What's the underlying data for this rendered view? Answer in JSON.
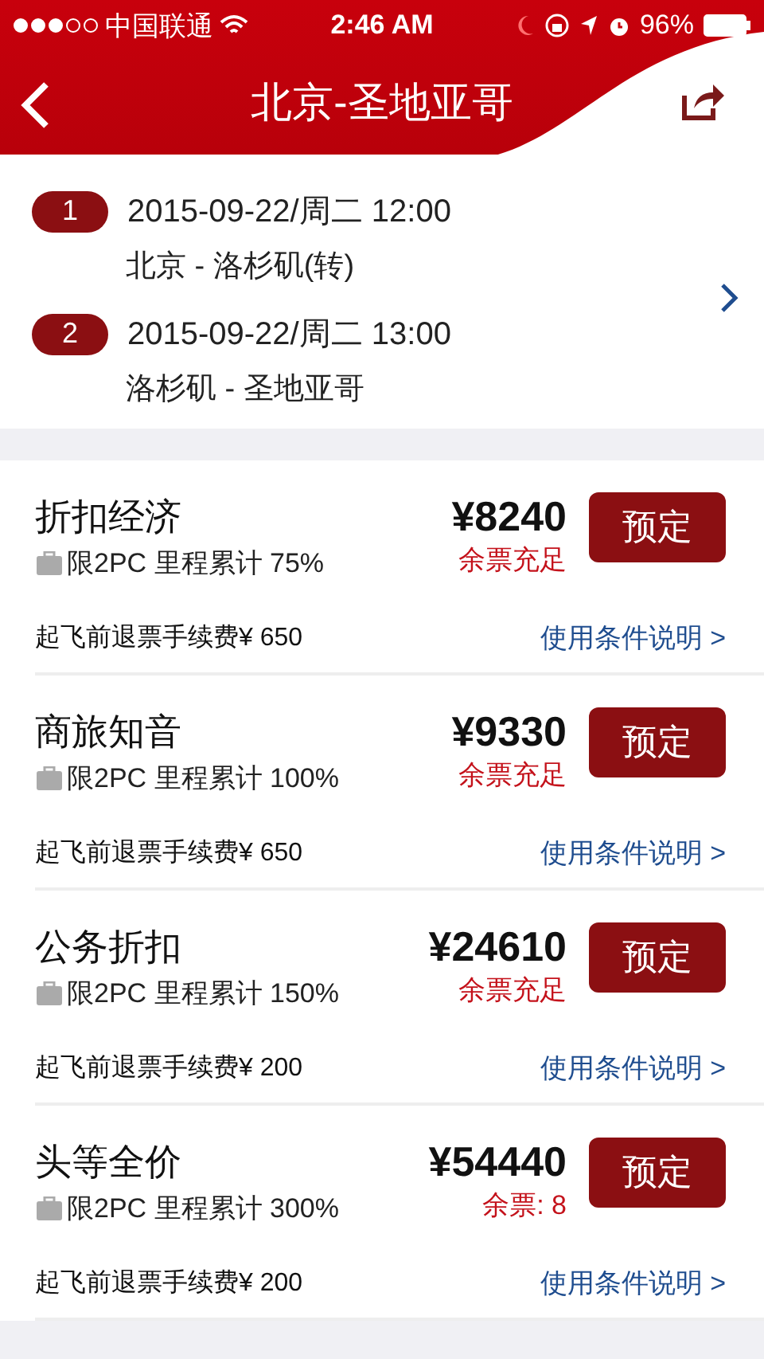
{
  "status_bar": {
    "carrier": "中国联通",
    "time": "2:46 AM",
    "battery": "96%"
  },
  "header": {
    "title": "北京-圣地亚哥"
  },
  "segments": [
    {
      "number": "1",
      "datetime": "2015-09-22/周二 12:00",
      "route": "北京 - 洛杉矶(转)"
    },
    {
      "number": "2",
      "datetime": "2015-09-22/周二 13:00",
      "route": "洛杉矶 - 圣地亚哥"
    }
  ],
  "fares": [
    {
      "name": "折扣经济",
      "baggage": "限2PC 里程累计 75%",
      "price": "¥8240",
      "availability": "余票充足",
      "button": "预定",
      "refund": "起飞前退票手续费¥ 650",
      "terms": "使用条件说明 >"
    },
    {
      "name": "商旅知音",
      "baggage": "限2PC 里程累计 100%",
      "price": "¥9330",
      "availability": "余票充足",
      "button": "预定",
      "refund": "起飞前退票手续费¥ 650",
      "terms": "使用条件说明 >"
    },
    {
      "name": "公务折扣",
      "baggage": "限2PC 里程累计 150%",
      "price": "¥24610",
      "availability": "余票充足",
      "button": "预定",
      "refund": "起飞前退票手续费¥ 200",
      "terms": "使用条件说明 >"
    },
    {
      "name": "头等全价",
      "baggage": "限2PC 里程累计 300%",
      "price": "¥54440",
      "availability": "余票: 8",
      "button": "预定",
      "refund": "起飞前退票手续费¥ 200",
      "terms": "使用条件说明 >"
    }
  ]
}
